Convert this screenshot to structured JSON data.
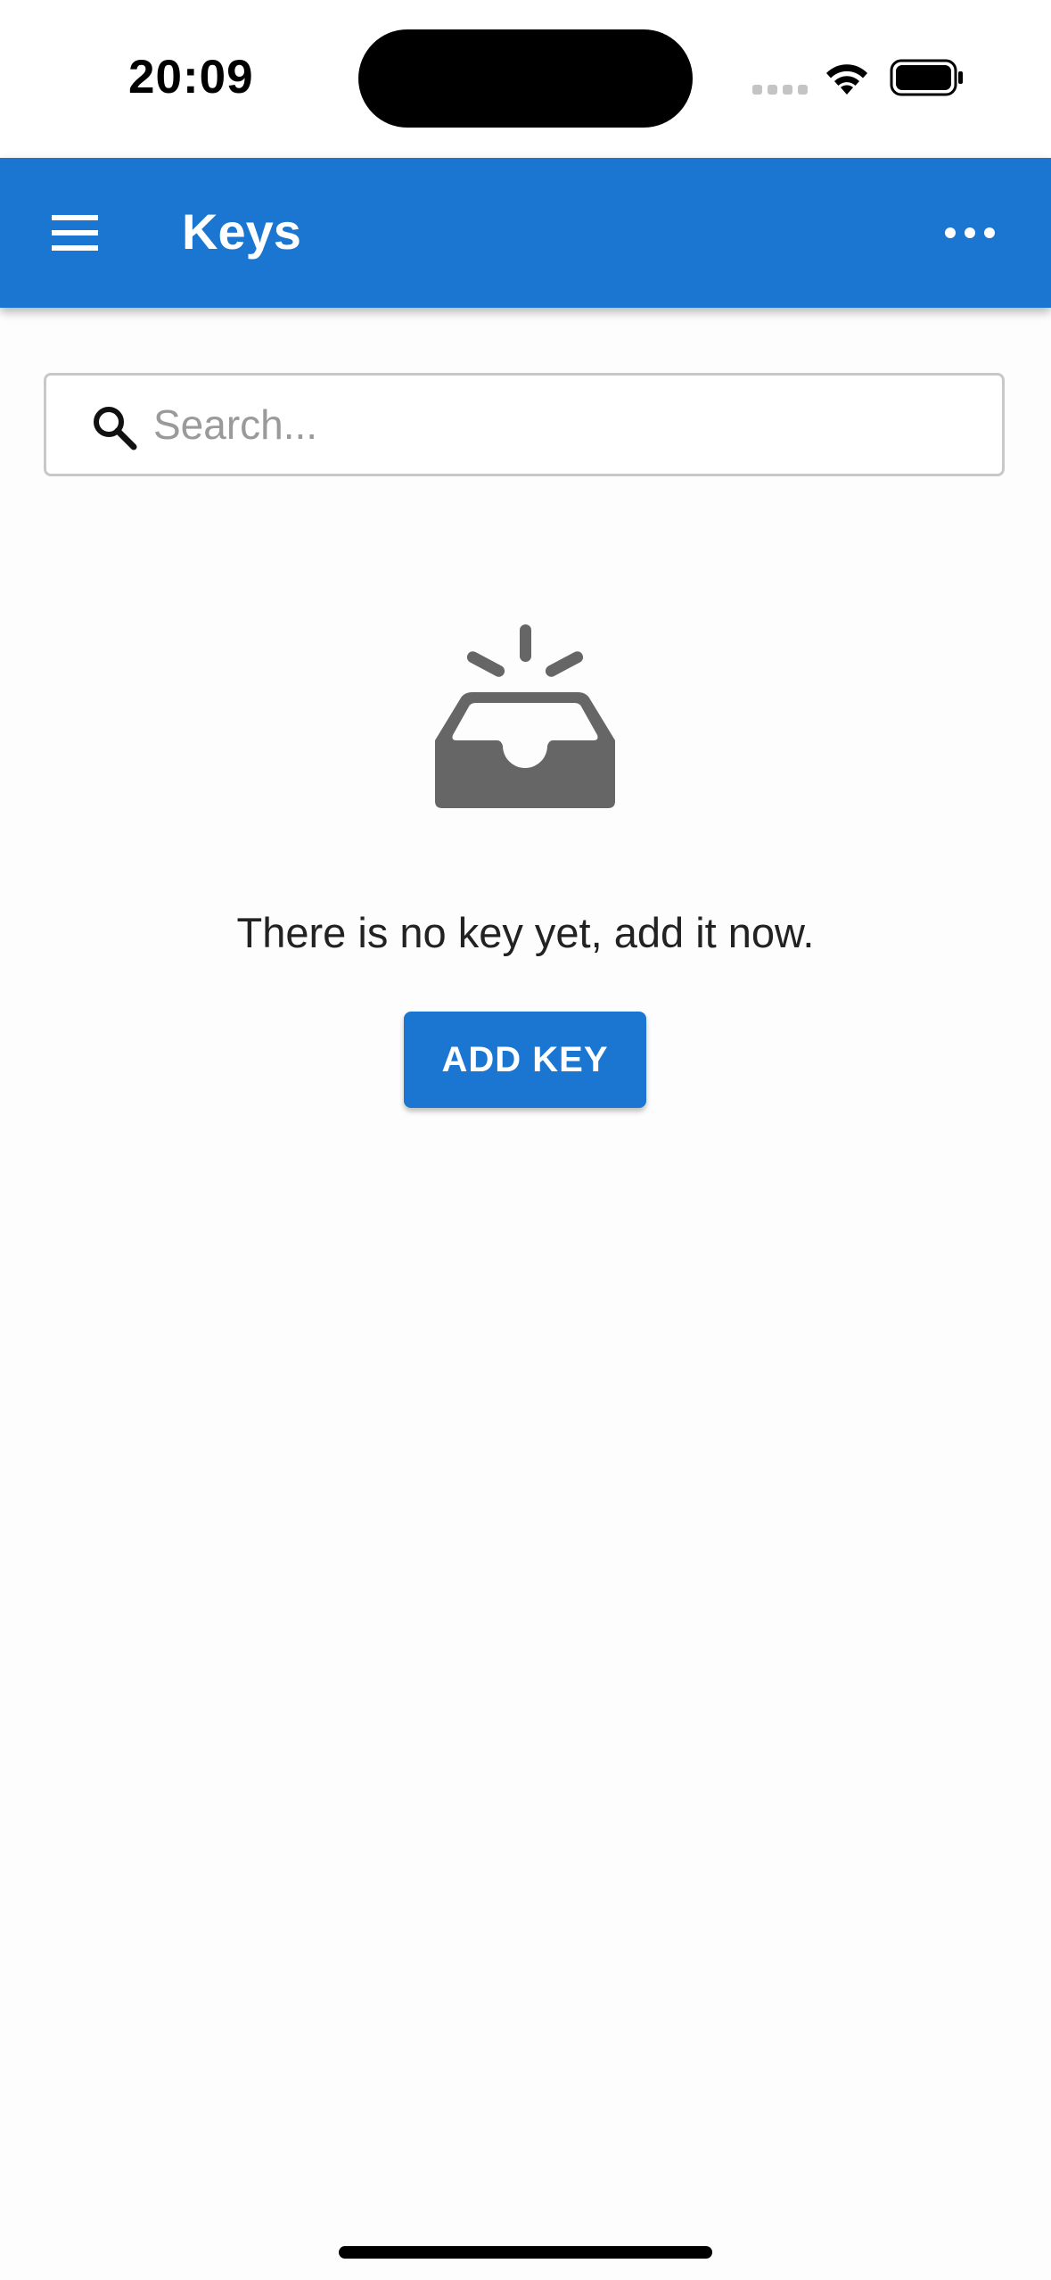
{
  "status_bar": {
    "time": "20:09"
  },
  "app_bar": {
    "title": "Keys",
    "menu_icon": "hamburger-menu-icon",
    "more_icon": "more-horizontal-icon",
    "color": "#1b76d2"
  },
  "search": {
    "placeholder": "Search...",
    "value": "",
    "icon": "search-icon"
  },
  "empty_state": {
    "icon": "empty-inbox-icon",
    "message": "There is no key yet, add it now.",
    "button_label": "ADD KEY"
  },
  "colors": {
    "accent": "#1b76d2",
    "icon_gray": "#666666"
  }
}
